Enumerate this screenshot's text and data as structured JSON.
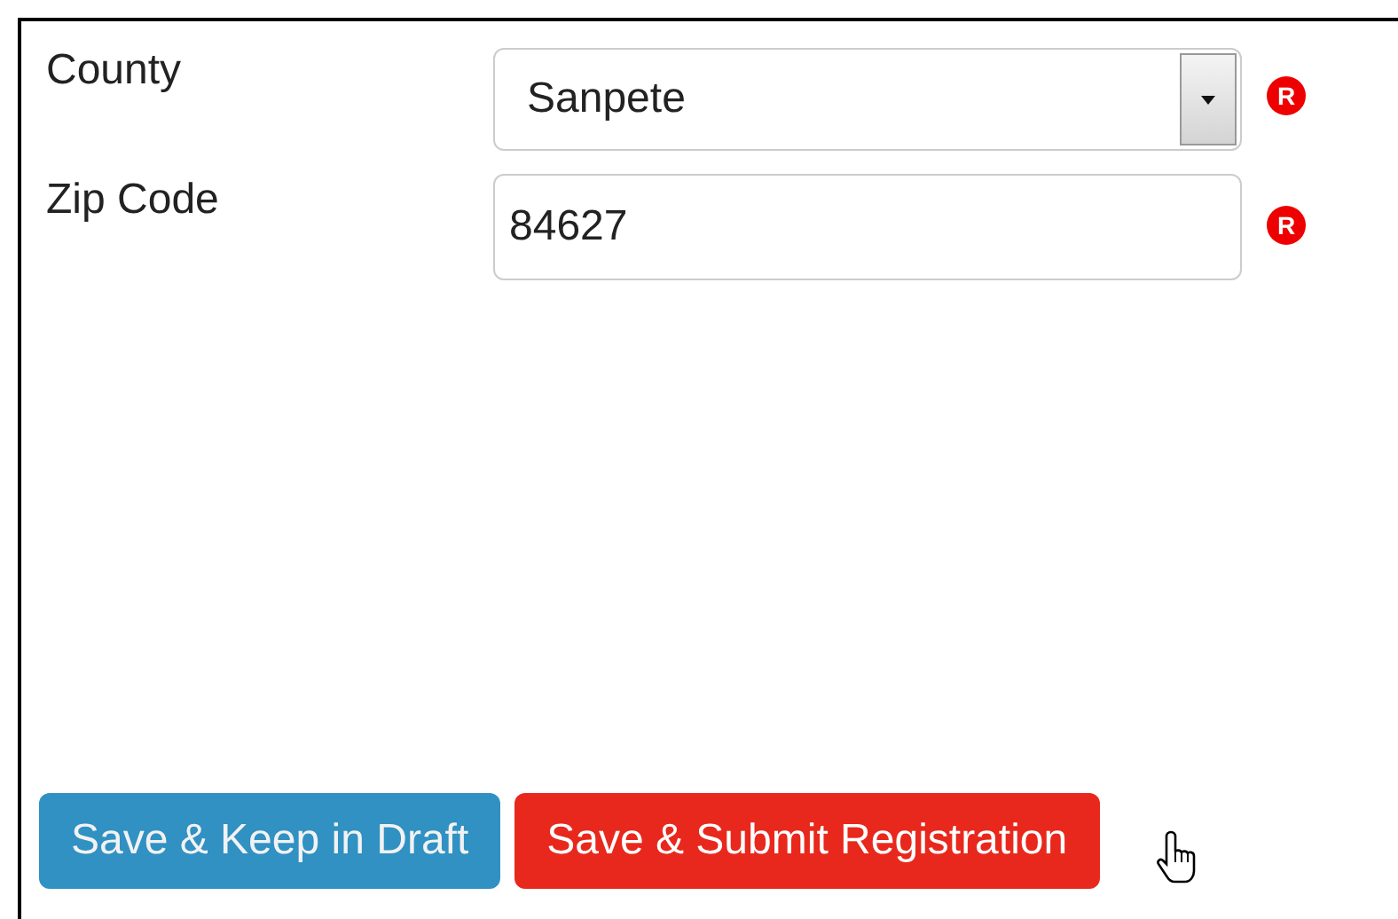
{
  "fields": [
    {
      "kind": "select",
      "label": "County",
      "value": "Sanpete",
      "required": true,
      "required_mark": "R"
    },
    {
      "kind": "text",
      "label": "Zip Code",
      "value": "84627",
      "required": true,
      "required_mark": "R"
    }
  ],
  "buttons": [
    {
      "kind": "secondary",
      "label": "Save & Keep in Draft",
      "hovered": false
    },
    {
      "kind": "primary",
      "label": "Save & Submit Registration",
      "hovered": true
    }
  ]
}
